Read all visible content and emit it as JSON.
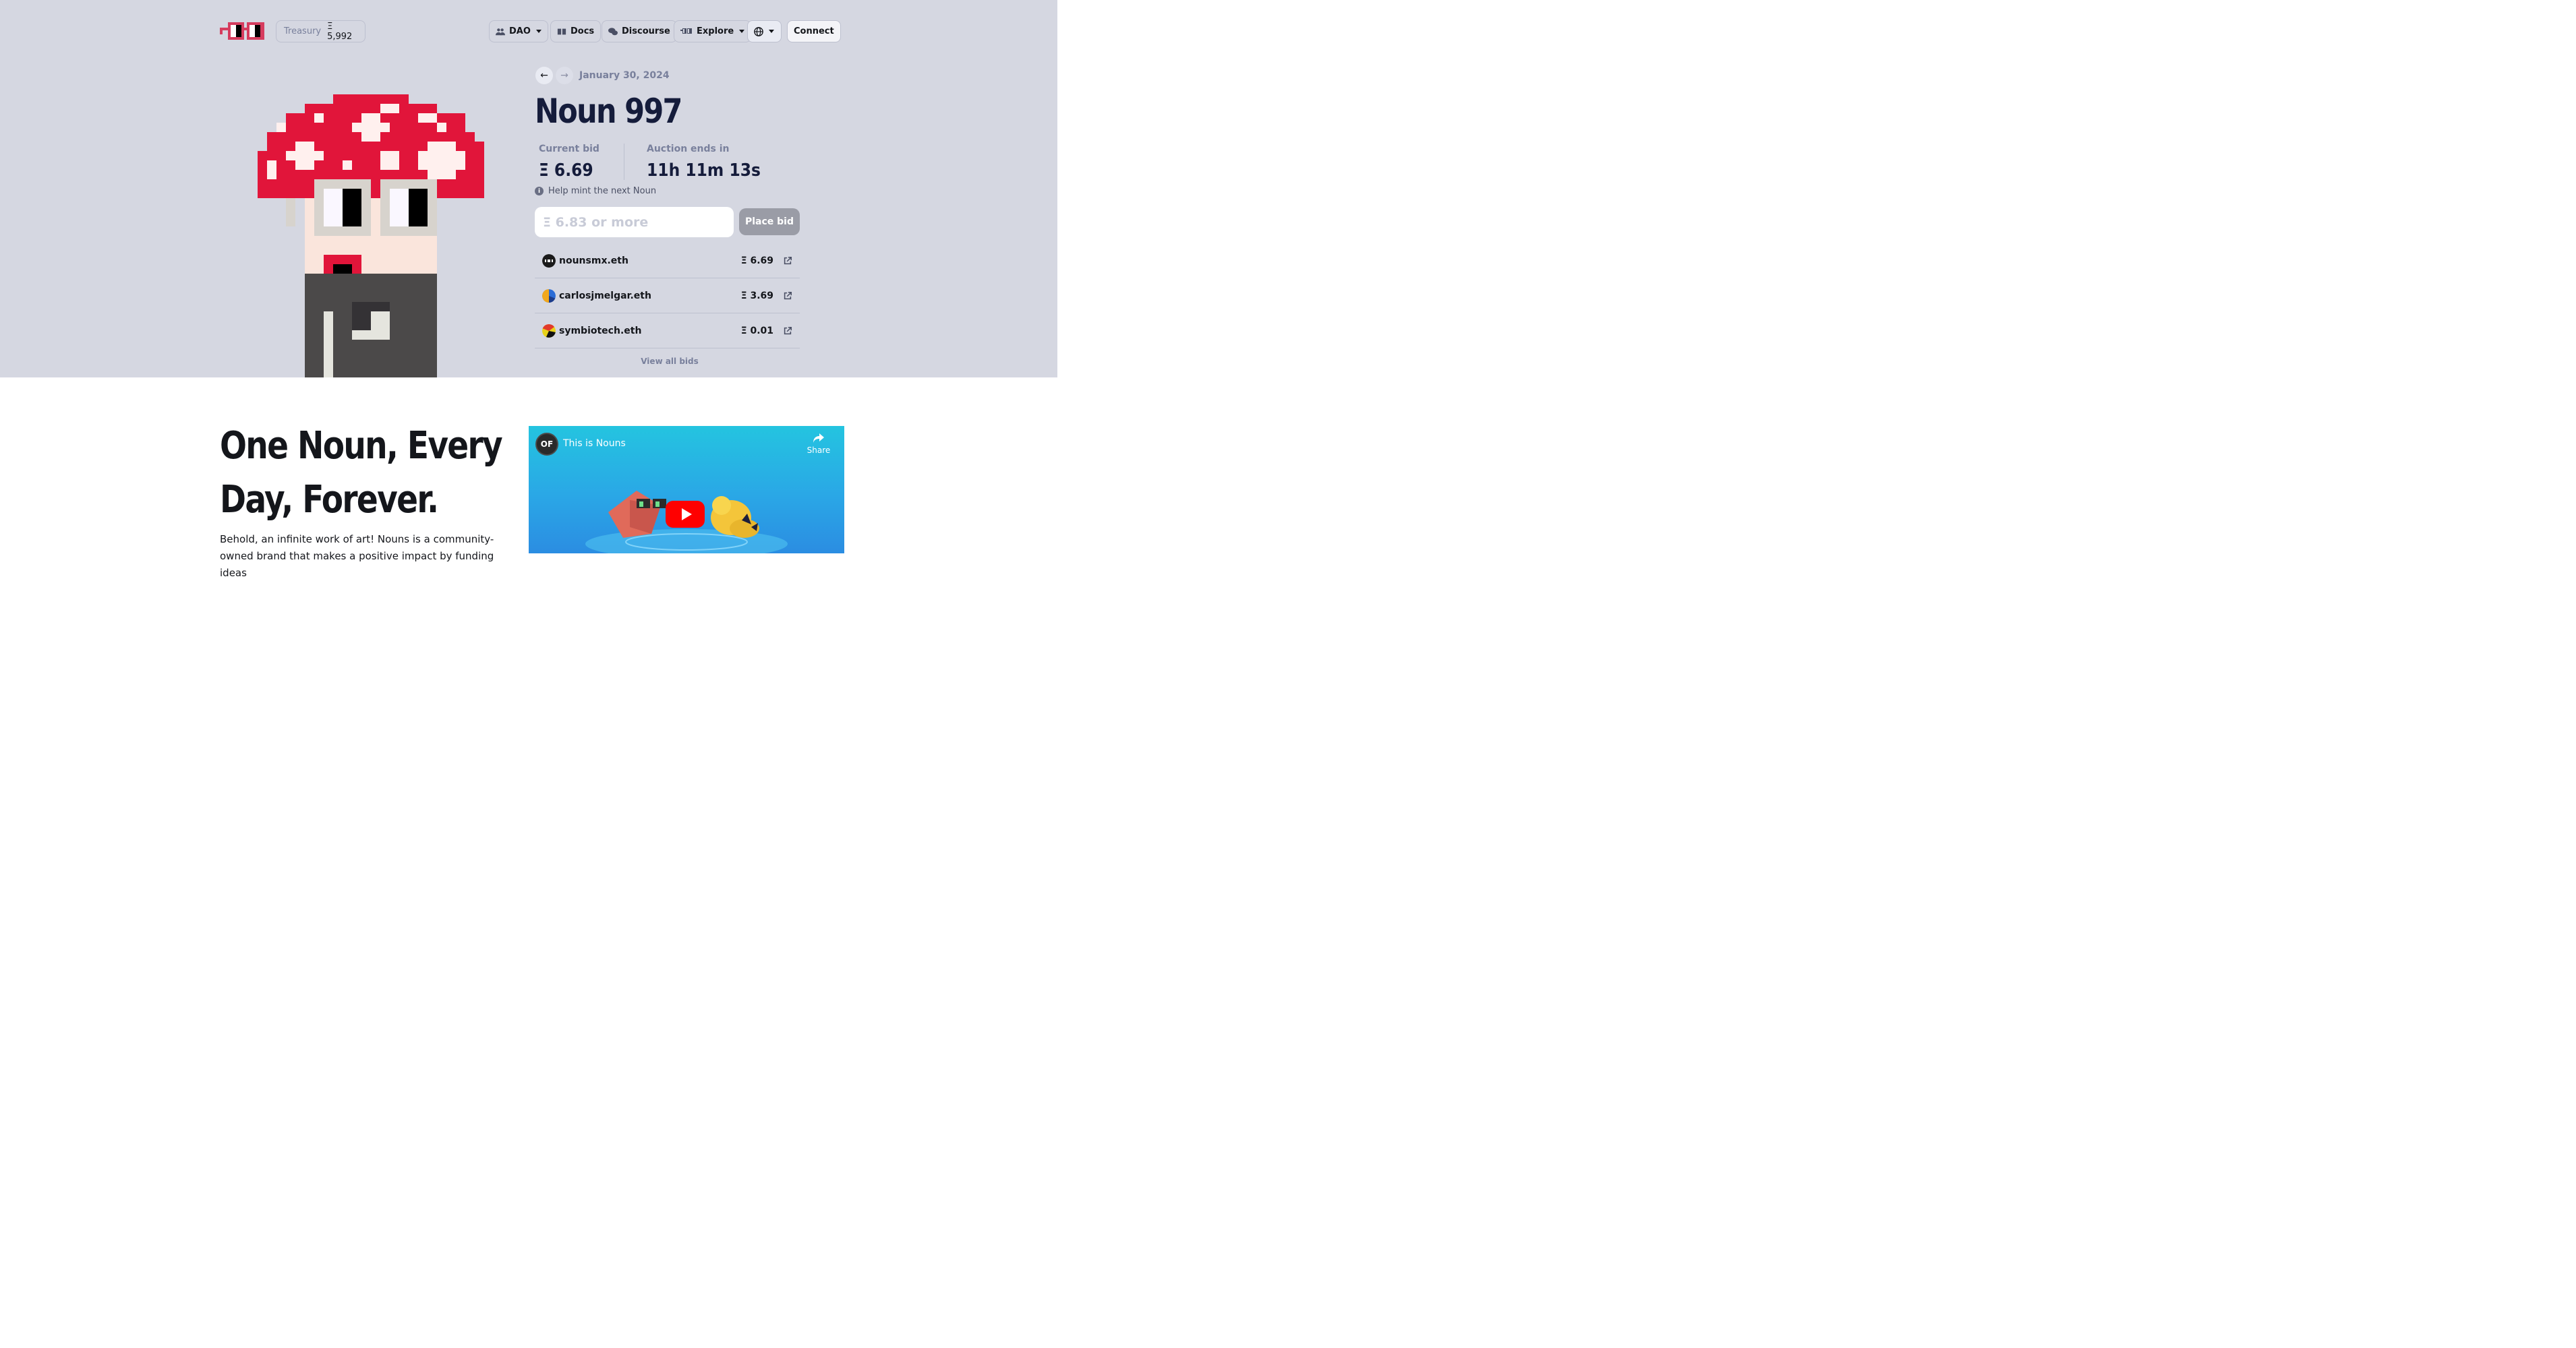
{
  "header": {
    "treasury_label": "Treasury",
    "treasury_value": "Ξ 5,992",
    "nav": {
      "dao": "DAO",
      "docs": "Docs",
      "discourse": "Discourse",
      "explore": "Explore",
      "connect": "Connect"
    },
    "icons": [
      "nouns-logo",
      "people-icon",
      "book-icon",
      "chat-icon",
      "glasses-icon",
      "globe-icon"
    ]
  },
  "auction": {
    "prev_arrow": "←",
    "next_arrow": "→",
    "date": "January 30, 2024",
    "title": "Noun 997",
    "current_bid_label": "Current bid",
    "current_bid_value": "Ξ 6.69",
    "ends_label": "Auction ends in",
    "ends_value": "11h 11m 13s",
    "help_text": "Help mint the next Noun",
    "bid_placeholder": "Ξ 6.83 or more",
    "place_bid_label": "Place bid",
    "bids": [
      {
        "address": "nounsmx.eth",
        "amount": "Ξ 6.69"
      },
      {
        "address": "carlosjmelgar.eth",
        "amount": "Ξ 3.69"
      },
      {
        "address": "symbiotech.eth",
        "amount": "Ξ 0.01"
      }
    ],
    "view_all": "View all bids"
  },
  "about": {
    "heading_line1": "One Noun, Every",
    "heading_line2": "Day, Forever.",
    "body": "Behold, an infinite work of art! Nouns is a community-owned brand that makes a positive impact by funding ideas"
  },
  "video": {
    "channel_initials": "OF",
    "title": "This is Nouns",
    "share_label": "Share"
  },
  "colors": {
    "hero_bg": "#d5d7e1",
    "accent_red": "#e1153a",
    "place_bid_disabled": "#9a9ca6"
  }
}
